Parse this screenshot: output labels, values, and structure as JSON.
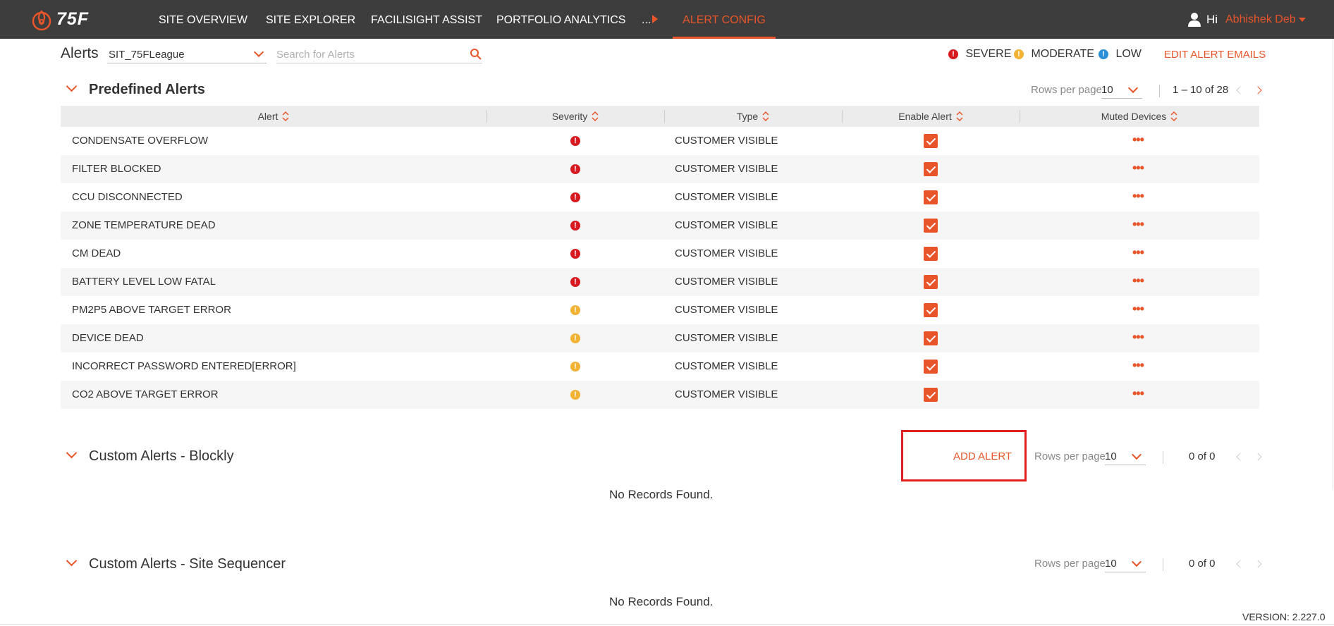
{
  "nav": {
    "logo_text": "75F",
    "items": [
      "SITE OVERVIEW",
      "SITE EXPLORER",
      "FACILISIGHT ASSIST",
      "PORTFOLIO ANALYTICS",
      "..."
    ],
    "active": "ALERT CONFIG",
    "greeting": "Hi",
    "user_name": "Abhishek Deb"
  },
  "header": {
    "title": "Alerts",
    "site": "SIT_75FLeague",
    "search_placeholder": "Search for Alerts",
    "legend": {
      "severe": "SEVERE",
      "moderate": "MODERATE",
      "low": "LOW"
    },
    "edit_emails": "EDIT ALERT EMAILS"
  },
  "colors": {
    "accent": "#e8552a",
    "severe": "#d71920",
    "moderate": "#f2b233",
    "low": "#2a8fd6",
    "nav_bg": "#3d3d3d"
  },
  "predefined": {
    "title": "Predefined Alerts",
    "rows_per_page_label": "Rows per page",
    "rows_per_page": "10",
    "range": "1 – 10 of 28",
    "columns": [
      "Alert",
      "Severity",
      "Type",
      "Enable Alert",
      "Muted Devices"
    ],
    "rows": [
      {
        "alert": "CONDENSATE OVERFLOW",
        "severity": "severe",
        "type": "CUSTOMER VISIBLE",
        "enabled": true
      },
      {
        "alert": "FILTER BLOCKED",
        "severity": "severe",
        "type": "CUSTOMER VISIBLE",
        "enabled": true
      },
      {
        "alert": "CCU DISCONNECTED",
        "severity": "severe",
        "type": "CUSTOMER VISIBLE",
        "enabled": true
      },
      {
        "alert": "ZONE TEMPERATURE DEAD",
        "severity": "severe",
        "type": "CUSTOMER VISIBLE",
        "enabled": true
      },
      {
        "alert": "CM DEAD",
        "severity": "severe",
        "type": "CUSTOMER VISIBLE",
        "enabled": true
      },
      {
        "alert": "BATTERY LEVEL LOW FATAL",
        "severity": "severe",
        "type": "CUSTOMER VISIBLE",
        "enabled": true
      },
      {
        "alert": "PM2P5 ABOVE TARGET ERROR",
        "severity": "moderate",
        "type": "CUSTOMER VISIBLE",
        "enabled": true
      },
      {
        "alert": "DEVICE DEAD",
        "severity": "moderate",
        "type": "CUSTOMER VISIBLE",
        "enabled": true
      },
      {
        "alert": "INCORRECT PASSWORD ENTERED[ERROR]",
        "severity": "moderate",
        "type": "CUSTOMER VISIBLE",
        "enabled": true
      },
      {
        "alert": "CO2 ABOVE TARGET ERROR",
        "severity": "moderate",
        "type": "CUSTOMER VISIBLE",
        "enabled": true
      }
    ]
  },
  "blockly": {
    "title": "Custom Alerts - Blockly",
    "add_alert": "ADD ALERT",
    "rows_per_page_label": "Rows per page",
    "rows_per_page": "10",
    "range": "0 of 0",
    "empty": "No Records Found."
  },
  "sequencer": {
    "title": "Custom Alerts - Site Sequencer",
    "rows_per_page_label": "Rows per page",
    "rows_per_page": "10",
    "range": "0 of 0",
    "empty": "No Records Found."
  },
  "version": "VERSION: 2.227.0"
}
